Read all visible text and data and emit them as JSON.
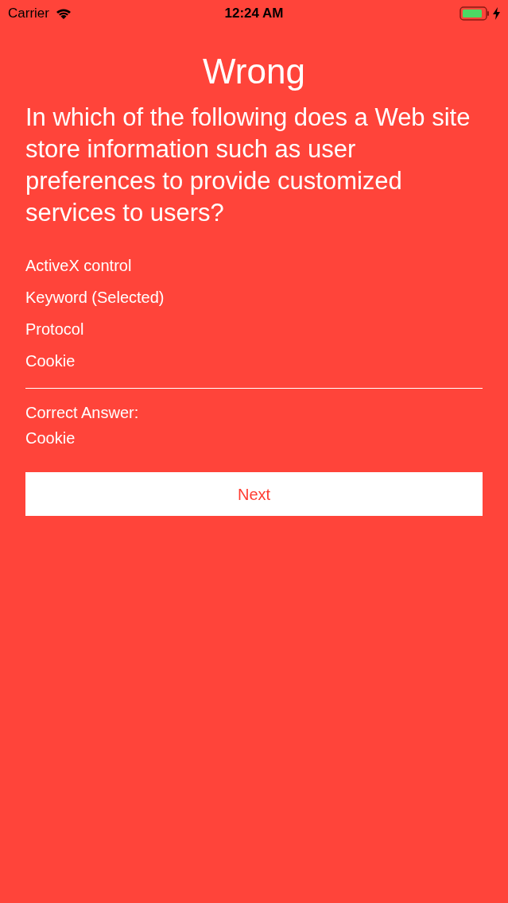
{
  "status_bar": {
    "carrier": "Carrier",
    "time": "12:24 AM"
  },
  "result": {
    "title": "Wrong"
  },
  "question": "In which of the following does a Web site store information such as user preferences to provide customized services to users?",
  "options": [
    "ActiveX control",
    "Keyword (Selected)",
    "Protocol",
    "Cookie"
  ],
  "correct_answer": {
    "label": "Correct Answer:",
    "value": "Cookie"
  },
  "next_button": {
    "label": "Next"
  }
}
